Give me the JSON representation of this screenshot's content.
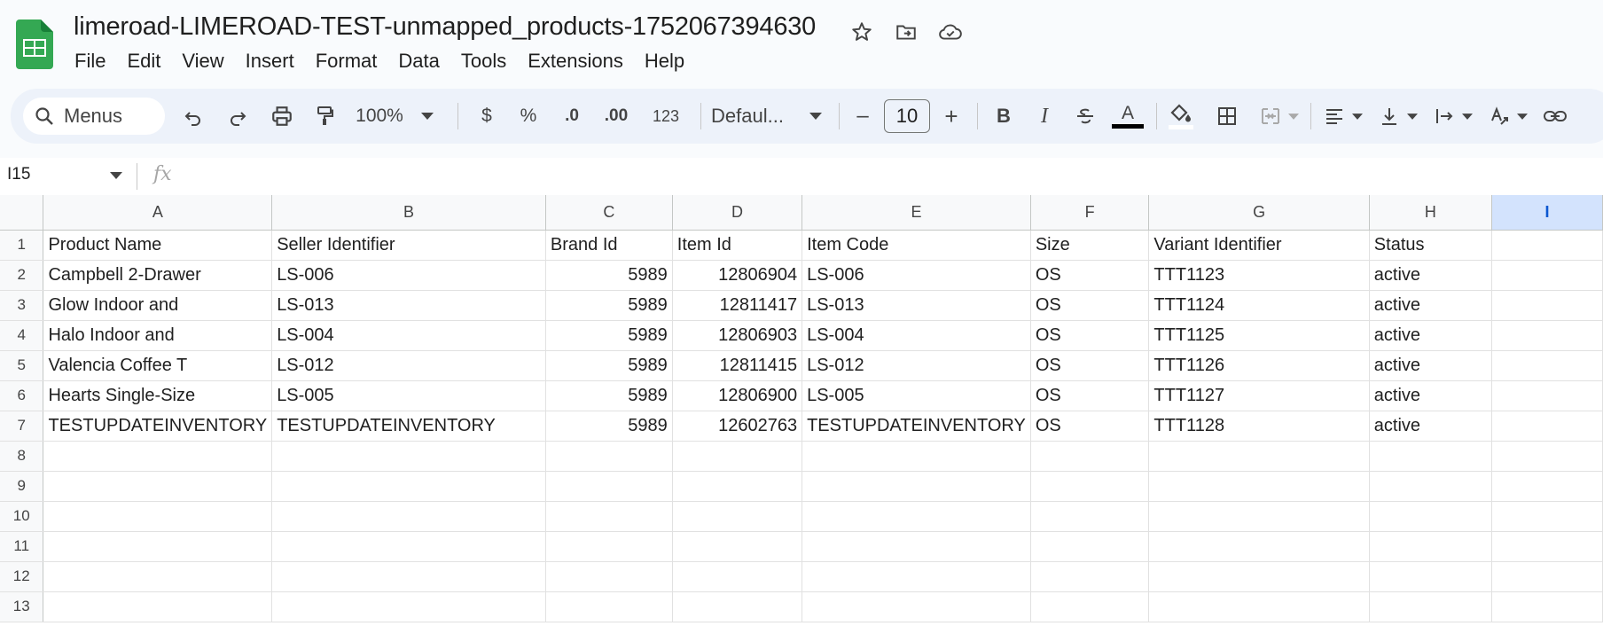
{
  "document": {
    "title": "limeroad-LIMEROAD-TEST-unmapped_products-1752067394630",
    "icons": [
      "star-icon",
      "move-to-folder-icon",
      "cloud-saved-icon"
    ]
  },
  "menubar": [
    "File",
    "Edit",
    "View",
    "Insert",
    "Format",
    "Data",
    "Tools",
    "Extensions",
    "Help"
  ],
  "toolbar": {
    "search_label": "Menus",
    "zoom": "100%",
    "currency": "$",
    "percent": "%",
    "decrease_decimal": ".0",
    "increase_decimal": ".00",
    "number_format": "123",
    "font": "Defaul...",
    "font_size": "10",
    "minus": "–",
    "plus": "+",
    "bold": "B",
    "italic": "I",
    "text_color_letter": "A",
    "text_color": "#000000"
  },
  "formula_bar": {
    "cell_ref": "I15",
    "fx": "fx",
    "value": ""
  },
  "grid": {
    "columns": [
      "A",
      "B",
      "C",
      "D",
      "E",
      "F",
      "G",
      "H",
      "I"
    ],
    "selected_column": "I",
    "rows": [
      {
        "n": "1",
        "cells": [
          "Product Name",
          "Seller Identifier",
          "Brand Id",
          "Item Id",
          "Item Code",
          "Size",
          "Variant Identifier",
          "Status",
          ""
        ]
      },
      {
        "n": "2",
        "cells": [
          "Campbell 2-Drawer",
          "LS-006",
          "5989",
          "12806904",
          "LS-006",
          "OS",
          "TTT1123",
          "active",
          ""
        ]
      },
      {
        "n": "3",
        "cells": [
          "Glow Indoor and",
          "LS-013",
          "5989",
          "12811417",
          "LS-013",
          "OS",
          "TTT1124",
          "active",
          ""
        ]
      },
      {
        "n": "4",
        "cells": [
          "Halo Indoor and",
          "LS-004",
          "5989",
          "12806903",
          "LS-004",
          "OS",
          "TTT1125",
          "active",
          ""
        ]
      },
      {
        "n": "5",
        "cells": [
          "Valencia Coffee T",
          "LS-012",
          "5989",
          "12811415",
          "LS-012",
          "OS",
          "TTT1126",
          "active",
          ""
        ]
      },
      {
        "n": "6",
        "cells": [
          "Hearts Single-Size",
          "LS-005",
          "5989",
          "12806900",
          "LS-005",
          "OS",
          "TTT1127",
          "active",
          ""
        ]
      },
      {
        "n": "7",
        "cells": [
          "TESTUPDATEINVENTORY",
          "TESTUPDATEINVENTORY",
          "5989",
          "12602763",
          "TESTUPDATEINVENTORY",
          "OS",
          "TTT1128",
          "active",
          ""
        ]
      },
      {
        "n": "8",
        "cells": [
          "",
          "",
          "",
          "",
          "",
          "",
          "",
          "",
          ""
        ]
      },
      {
        "n": "9",
        "cells": [
          "",
          "",
          "",
          "",
          "",
          "",
          "",
          "",
          ""
        ]
      },
      {
        "n": "10",
        "cells": [
          "",
          "",
          "",
          "",
          "",
          "",
          "",
          "",
          ""
        ]
      },
      {
        "n": "11",
        "cells": [
          "",
          "",
          "",
          "",
          "",
          "",
          "",
          "",
          ""
        ]
      },
      {
        "n": "12",
        "cells": [
          "",
          "",
          "",
          "",
          "",
          "",
          "",
          "",
          ""
        ]
      },
      {
        "n": "13",
        "cells": [
          "",
          "",
          "",
          "",
          "",
          "",
          "",
          "",
          ""
        ]
      }
    ]
  }
}
